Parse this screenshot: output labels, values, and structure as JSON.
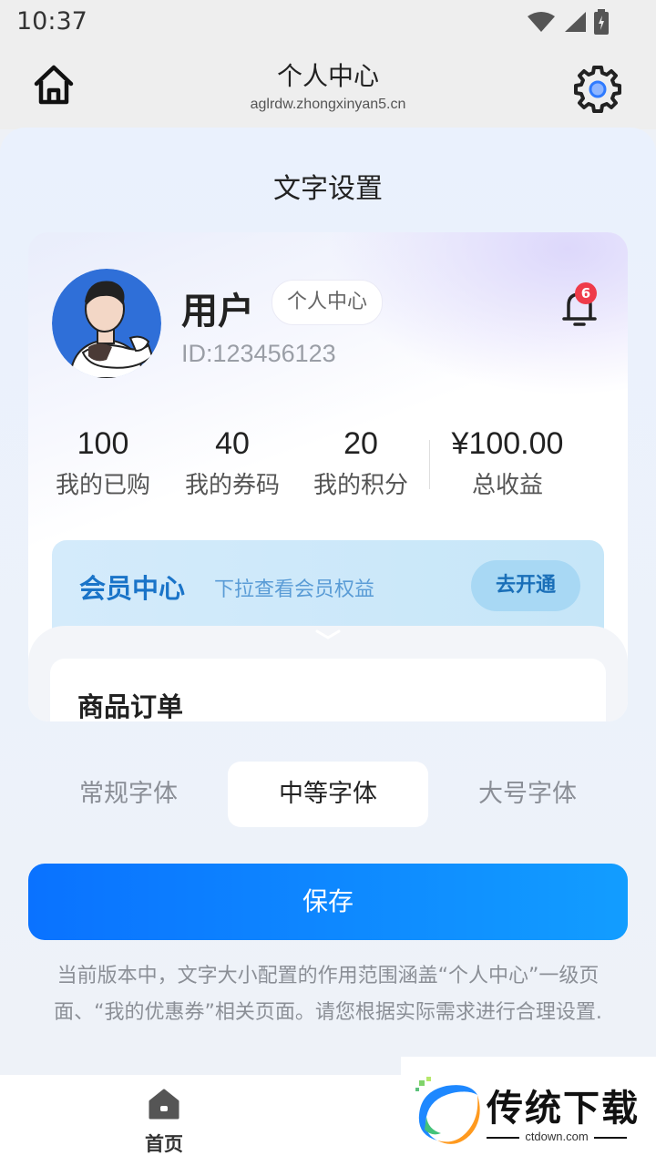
{
  "status": {
    "time": "10:37"
  },
  "nav": {
    "title": "个人中心",
    "url": "aglrdw.zhongxinyan5.cn"
  },
  "sheet": {
    "title": "文字设置"
  },
  "preview": {
    "username": "用户",
    "tag": "个人中心",
    "user_id": "ID:123456123",
    "bell_badge": "6",
    "stats": [
      {
        "value": "100",
        "label": "我的已购"
      },
      {
        "value": "40",
        "label": "我的券码"
      },
      {
        "value": "20",
        "label": "我的积分"
      },
      {
        "value": "¥100.00",
        "label": "总收益"
      }
    ],
    "vip": {
      "title": "会员中心",
      "subtitle": "下拉查看会员权益",
      "button": "去开通"
    },
    "orders_title": "商品订单"
  },
  "font_options": {
    "items": [
      "常规字体",
      "中等字体",
      "大号字体"
    ],
    "selected": "中等字体"
  },
  "save_label": "保存",
  "note": "当前版本中，文字大小配置的作用范围涵盖“个人中心”一级页面、“我的优惠券”相关页面。请您根据实际需求进行合理设置.",
  "tabbar": {
    "home_label": "首页"
  },
  "watermark": {
    "text": "传统下载",
    "domain": "ctdown.com"
  },
  "colors": {
    "primary": "#0a72ff",
    "vip_text": "#1a74c8",
    "badge": "#ef3b4a"
  }
}
